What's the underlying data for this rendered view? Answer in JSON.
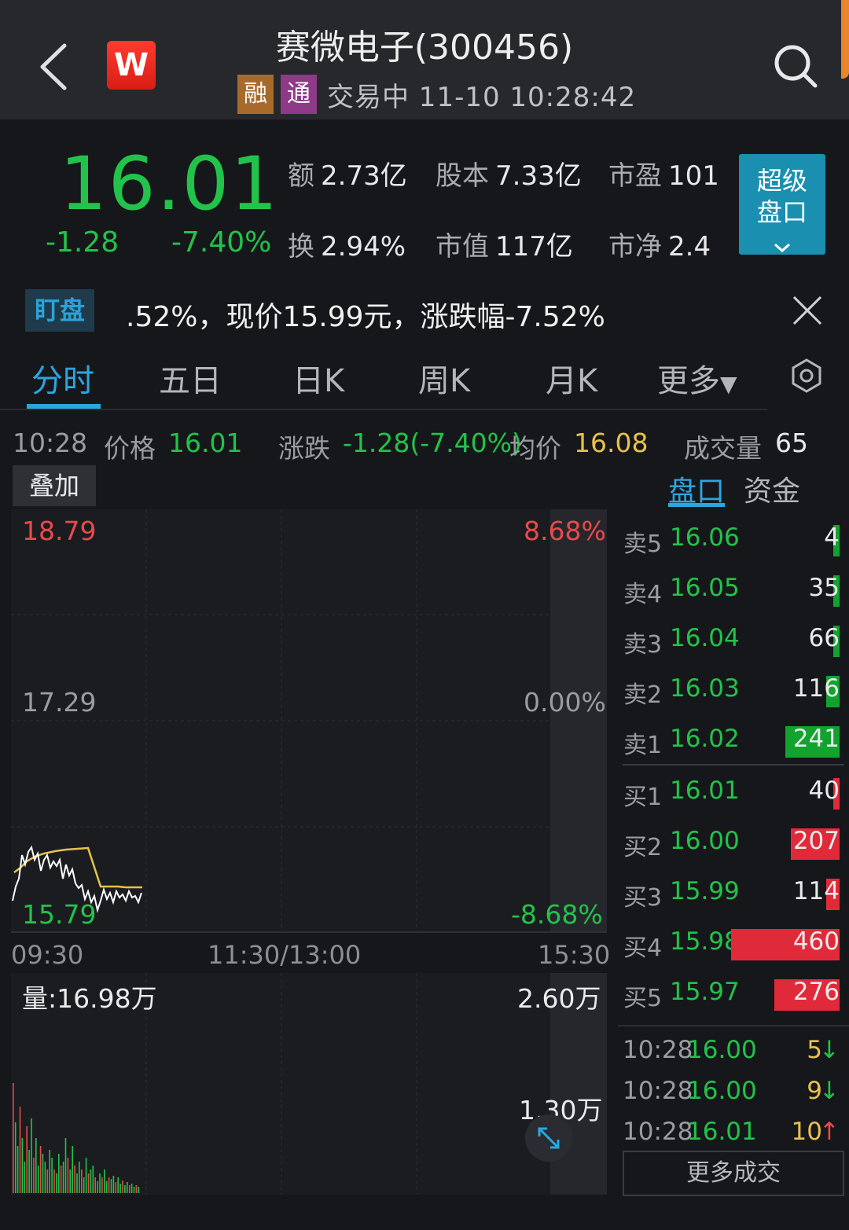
{
  "header": {
    "title": "赛微电子(300456)",
    "logo_text": "W",
    "tags": [
      "融",
      "通"
    ],
    "status": "交易中 11-10 10:28:42",
    "accent_color": "#e8842a"
  },
  "quote": {
    "price": "16.01",
    "change": "-1.28",
    "change_pct": "-7.40%",
    "metrics": [
      {
        "k": "额",
        "v": "2.73亿"
      },
      {
        "k": "股本",
        "v": "7.33亿"
      },
      {
        "k": "市盈",
        "v": "101"
      },
      {
        "k": "换",
        "v": "2.94%"
      },
      {
        "k": "市值",
        "v": "117亿"
      },
      {
        "k": "市净",
        "v": "2.4"
      }
    ],
    "super_button": "超级盘口"
  },
  "watch": {
    "label": "盯盘",
    "text": ".52%，现价15.99元，涨跌幅-7.52%"
  },
  "tabs": [
    "分时",
    "五日",
    "日K",
    "周K",
    "月K",
    "更多"
  ],
  "info": {
    "time": "10:28",
    "price_label": "价格",
    "price": "16.01",
    "change_label": "涨跌",
    "change": "-1.28(-7.40%)",
    "avg_label": "均价",
    "avg": "16.08",
    "vol_label": "成交量",
    "vol": "65"
  },
  "overlay_label": "叠加",
  "side_tabs": [
    "盘口",
    "资金"
  ],
  "chart": {
    "price_high": "18.79",
    "price_mid": "17.29",
    "price_low": "15.79",
    "pct_high": "8.68%",
    "pct_mid": "0.00%",
    "pct_low": "-8.68%",
    "time_start": "09:30",
    "time_mid": "11:30/13:00",
    "time_end": "15:30",
    "vol_title": "量:16.98万",
    "vol_max": "2.60万",
    "vol_mid": "1.30万",
    "colors": {
      "up": "#e84a4a",
      "down": "#22c34a",
      "avg": "#e8c14a",
      "line": "#ffffff"
    }
  },
  "order_book": {
    "asks": [
      {
        "label": "卖5",
        "price": "16.06",
        "qty": "4",
        "fill": 0.02
      },
      {
        "label": "卖4",
        "price": "16.05",
        "qty": "35",
        "fill": 0.03
      },
      {
        "label": "卖3",
        "price": "16.04",
        "qty": "66",
        "fill": 0.06
      },
      {
        "label": "卖2",
        "price": "16.03",
        "qty": "116",
        "fill": 0.12
      },
      {
        "label": "卖1",
        "price": "16.02",
        "qty": "241",
        "fill": 0.5
      }
    ],
    "bids": [
      {
        "label": "买1",
        "price": "16.01",
        "qty": "40",
        "fill": 0.04
      },
      {
        "label": "买2",
        "price": "16.00",
        "qty": "207",
        "fill": 0.45
      },
      {
        "label": "买3",
        "price": "15.99",
        "qty": "114",
        "fill": 0.12
      },
      {
        "label": "买4",
        "price": "15.98",
        "qty": "460",
        "fill": 1.0
      },
      {
        "label": "买5",
        "price": "15.97",
        "qty": "276",
        "fill": 0.6
      }
    ]
  },
  "trades": [
    {
      "time": "10:28",
      "price": "16.00",
      "qty": "5",
      "dir": "↓"
    },
    {
      "time": "10:28",
      "price": "16.00",
      "qty": "9",
      "dir": "↓"
    },
    {
      "time": "10:28",
      "price": "16.01",
      "qty": "10",
      "dir": "↑"
    }
  ],
  "more_trades": "更多成交"
}
